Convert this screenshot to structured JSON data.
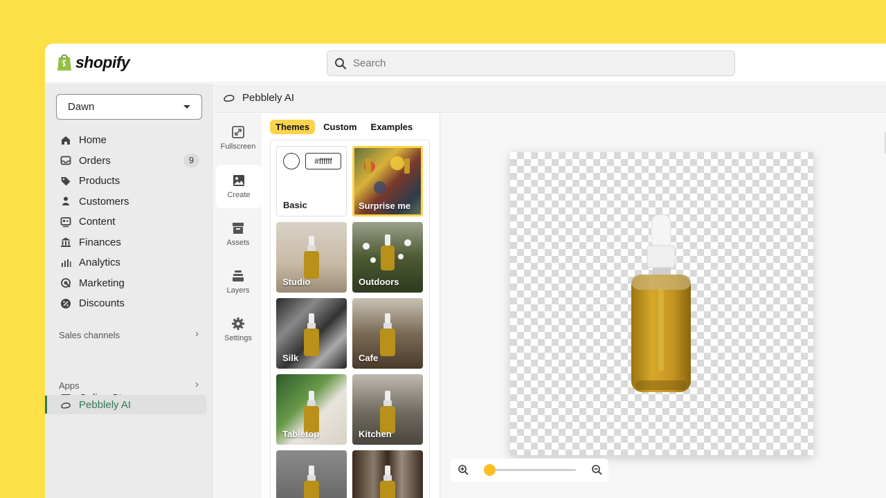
{
  "brand": {
    "name": "shopify"
  },
  "search": {
    "placeholder": "Search"
  },
  "store_selector": {
    "value": "Dawn"
  },
  "sidebar": {
    "items": [
      {
        "label": "Home",
        "icon": "home-icon"
      },
      {
        "label": "Orders",
        "icon": "inbox-icon",
        "badge": "9"
      },
      {
        "label": "Products",
        "icon": "tag-icon"
      },
      {
        "label": "Customers",
        "icon": "person-icon"
      },
      {
        "label": "Content",
        "icon": "content-icon"
      },
      {
        "label": "Finances",
        "icon": "bank-icon"
      },
      {
        "label": "Analytics",
        "icon": "bar-chart-icon"
      },
      {
        "label": "Marketing",
        "icon": "target-icon"
      },
      {
        "label": "Discounts",
        "icon": "discount-icon"
      }
    ],
    "sales_channels": {
      "title": "Sales channels",
      "items": [
        {
          "label": "Online Store",
          "icon": "store-icon"
        }
      ]
    },
    "apps": {
      "title": "Apps",
      "items": [
        {
          "label": "Pebblely AI",
          "icon": "pebble-icon"
        }
      ]
    }
  },
  "app": {
    "title": "Pebblely AI"
  },
  "toolbar": {
    "items": [
      {
        "label": "Fullscreen",
        "icon": "fullscreen-icon"
      },
      {
        "label": "Create",
        "icon": "image-icon"
      },
      {
        "label": "Assets",
        "icon": "archive-icon"
      },
      {
        "label": "Layers",
        "icon": "layers-icon"
      },
      {
        "label": "Settings",
        "icon": "gear-icon"
      }
    ],
    "active": "Create"
  },
  "panel": {
    "tabs": [
      "Themes",
      "Custom",
      "Examples"
    ],
    "active_tab": "Themes",
    "basic": {
      "label": "Basic",
      "color": "#ffffff"
    },
    "themes": [
      {
        "label": "Surprise me",
        "selected": true
      },
      {
        "label": "Studio"
      },
      {
        "label": "Outdoors"
      },
      {
        "label": "Silk"
      },
      {
        "label": "Cafe"
      },
      {
        "label": "Tabletop"
      },
      {
        "label": "Kitchen"
      },
      {
        "label": ""
      },
      {
        "label": ""
      }
    ]
  },
  "colors": {
    "accent": "#FCD34D",
    "background": "#FDE047",
    "active_nav": "#2f7a53"
  }
}
